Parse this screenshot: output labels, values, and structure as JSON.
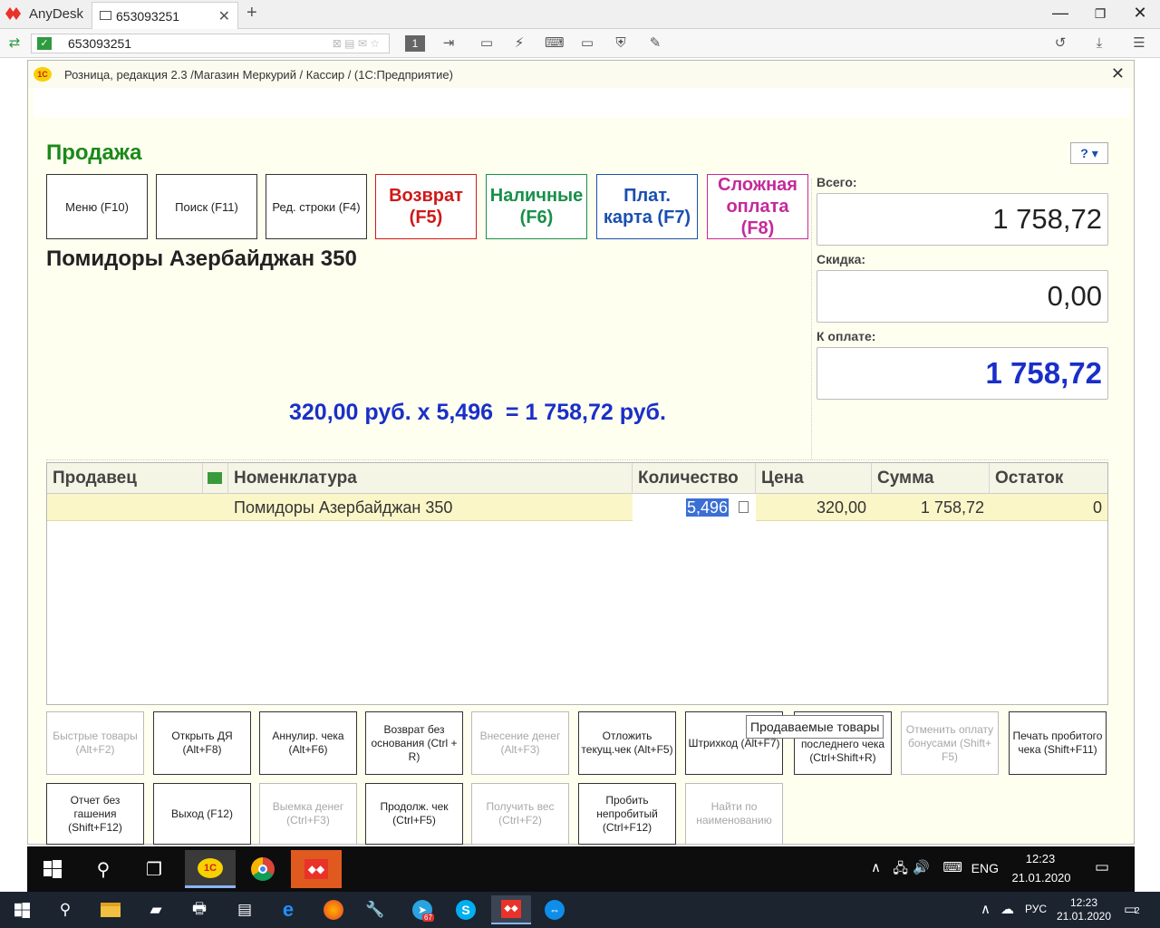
{
  "anydesk": {
    "app_name": "AnyDesk",
    "tab_label": "653093251",
    "address_value": "653093251",
    "session_badge": "1"
  },
  "onec": {
    "window_title": "Розница, редакция 2.3 /Магазин Меркурий / Кассир /  (1С:Предприятие)",
    "logo_text": "1С",
    "close_label": "✕",
    "help_label": "?",
    "sale_title": "Продажа",
    "top_buttons": [
      {
        "label": "Меню (F10)"
      },
      {
        "label": "Поиск (F11)"
      },
      {
        "label": "Ред. строки (F4)"
      },
      {
        "label": "Возврат (F5)",
        "color": "#d01818"
      },
      {
        "label": "Наличные (F6)",
        "color": "#18904a"
      },
      {
        "label": "Плат. карта (F7)",
        "color": "#1a4fb0"
      },
      {
        "label": "Сложная оплата (F8)",
        "color": "#c42a9a"
      }
    ],
    "product_name": "Помидоры Азербайджан 350",
    "formula": "320,00 руб. x 5,496  = 1 758,72 руб.",
    "totals": {
      "total_label": "Всего:",
      "total_value": "1 758,72",
      "discount_label": "Скидка:",
      "discount_value": "0,00",
      "to_pay_label": "К оплате:",
      "to_pay_value": "1 758,72",
      "to_pay_color": "#1a2fc8"
    },
    "table": {
      "headers": [
        "Продавец",
        "",
        "Номенклатура",
        "Количество",
        "Цена",
        "Сумма",
        "Остаток"
      ],
      "rows": [
        {
          "seller": "",
          "item": "Помидоры Азербайджан 350",
          "qty": "5,496",
          "price": "320,00",
          "sum": "1 758,72",
          "rest": "0"
        }
      ]
    },
    "bottom_buttons_row1": [
      {
        "label": "Быстрые товары (Alt+F2)",
        "disabled": true
      },
      {
        "label": "Открыть ДЯ (Alt+F8)",
        "disabled": false
      },
      {
        "label": "Аннулир. чека (Alt+F6)",
        "disabled": false
      },
      {
        "label": "Возврат без основания (Ctrl + R)",
        "disabled": false
      },
      {
        "label": "Внесение денег (Alt+F3)",
        "disabled": true
      },
      {
        "label": "Отложить текущ.чек (Alt+F5)",
        "disabled": false
      },
      {
        "label": "Штрихкод (Alt+F7)",
        "disabled": false
      },
      {
        "label": "последнего чека (Ctrl+Shift+R)",
        "disabled": false
      },
      {
        "label": "Отменить оплату бонусами (Shift+ F5)",
        "disabled": true
      },
      {
        "label": "Печать пробитого чека (Shift+F11)",
        "disabled": false
      }
    ],
    "bottom_buttons_row2": [
      {
        "label": "Отчет без гашения (Shift+F12)",
        "disabled": false
      },
      {
        "label": "Выход (F12)",
        "disabled": false
      },
      {
        "label": "Выемка денег (Ctrl+F3)",
        "disabled": true
      },
      {
        "label": "Продолж. чек (Ctrl+F5)",
        "disabled": false
      },
      {
        "label": "Получить вес (Ctrl+F2)",
        "disabled": true
      },
      {
        "label": "Пробить непробитый (Ctrl+F12)",
        "disabled": false
      },
      {
        "label": "Найти по наименованию",
        "disabled": true
      }
    ],
    "tooltip": "Продаваемые товары"
  },
  "remote_taskbar": {
    "lang": "ENG",
    "time": "12:23",
    "date": "21.01.2020"
  },
  "local_taskbar": {
    "lang": "РУС",
    "time": "12:23",
    "date": "21.01.2020",
    "telegram_badge": "67",
    "notif_badge": "2"
  }
}
